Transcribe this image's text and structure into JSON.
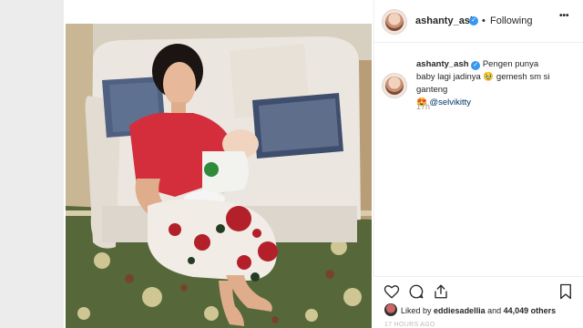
{
  "post": {
    "username": "ashanty_ash",
    "follow_label": "Following",
    "dot": "•",
    "more_label": "•••",
    "caption_text": "Pengen punya baby lagi jadinya",
    "caption_text_2": "gemesh sm si ganteng",
    "mention": "@selvikitty",
    "caption_time": "17h",
    "likes_prefix": "Liked by",
    "likes_user": "eddiesadellia",
    "likes_and": "and",
    "likes_count": "44,049 others",
    "posted_ago": "17 HOURS AGO"
  },
  "colors": {
    "verified": "#3897f0",
    "text": "#262626",
    "muted": "#999999"
  }
}
